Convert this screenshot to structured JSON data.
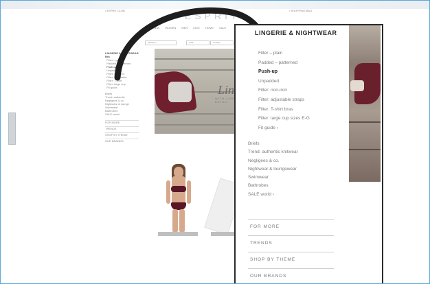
{
  "background_page": {
    "logo": "ESPRIT",
    "top_left_text": "• ESPRIT CLUB",
    "top_right_text": "• SHOPPING BAG",
    "nav": [
      "NEW",
      "WOMEN",
      "MEN",
      "KIDS",
      "HOME",
      "SALE"
    ],
    "search_pills": [
      "SEARCH",
      "SIZE",
      "STORE"
    ],
    "hero_caption": "Lingerie",
    "hero_sub": "WITH LOVE & DETAIL"
  },
  "panel": {
    "title": "LINGERIE & NIGHTWEAR",
    "subcategories": [
      {
        "label": "Filter – plain",
        "selected": false
      },
      {
        "label": "Padded – patterned",
        "selected": false
      },
      {
        "label": "Push-up",
        "selected": true
      },
      {
        "label": "Unpadded",
        "selected": false
      },
      {
        "label": "Filter: non-iron",
        "selected": false
      },
      {
        "label": "Filter: adjustable straps",
        "selected": false
      },
      {
        "label": "Filter: T-shirt bras",
        "selected": false
      },
      {
        "label": "Filter: large cup sizes E-G",
        "selected": false
      },
      {
        "label": "Fit guide ›",
        "selected": false
      }
    ],
    "categories": [
      "Briefs",
      "Trend: authentic knitwear",
      "Negligees & co.",
      "Nightwear & loungewear",
      "Swimwear",
      "Bathrobes",
      "SALE world ›"
    ],
    "sections": [
      "FOR MORE",
      "TRENDS",
      "SHOP BY THEME",
      "OUR BRANDS"
    ]
  },
  "colors": {
    "accent_frame": "#5aa8d8",
    "panel_border": "#2a2a2a",
    "burgundy": "#6f1f2e"
  },
  "icons": {
    "arrow": "curved-arrow-icon"
  }
}
